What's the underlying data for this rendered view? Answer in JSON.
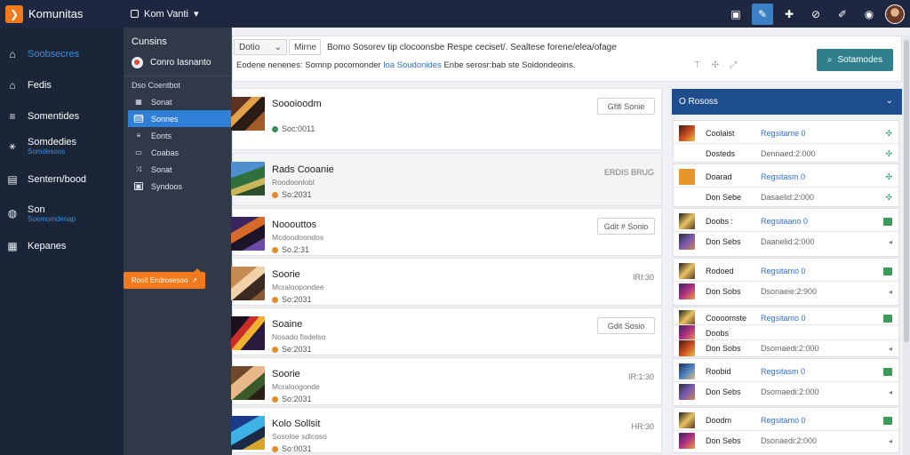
{
  "app": {
    "name": "Komunitas"
  },
  "workspace": {
    "label": "Kom Vanti"
  },
  "top_actions": [
    {
      "name": "calendar-icon",
      "glyph": "▣"
    },
    {
      "name": "edit-icon",
      "glyph": "✎"
    },
    {
      "name": "pin-icon",
      "glyph": "✚"
    },
    {
      "name": "attach-icon",
      "glyph": "⊘"
    },
    {
      "name": "wrench-icon",
      "glyph": "✐"
    },
    {
      "name": "notification-icon",
      "glyph": "◉"
    }
  ],
  "sidebar": {
    "items": [
      {
        "label": "Soobsecres",
        "icon": "home-icon",
        "glyph": "⌂",
        "blue": true
      },
      {
        "label": "Fedis",
        "icon": "house-icon",
        "glyph": "⌂"
      },
      {
        "label": "Somentides",
        "icon": "menu-icon",
        "glyph": "≡"
      },
      {
        "label": "Somdedies",
        "sub": "Somdesoos",
        "icon": "share-icon",
        "glyph": "⚹"
      },
      {
        "label": "Sentern/bood",
        "icon": "board-icon",
        "glyph": "▤"
      },
      {
        "label": "Son",
        "sub": "Soemomdenap",
        "icon": "globe-icon",
        "glyph": "◍"
      },
      {
        "label": "Kepanes",
        "icon": "chart-icon",
        "glyph": "▦"
      }
    ]
  },
  "dropdown": {
    "title": "Cunsins",
    "user": "Conro Iasnanto",
    "section": "Dso Coentbot",
    "items": [
      {
        "label": "Sonat",
        "icon": "grid-icon",
        "glyph": "▦"
      },
      {
        "label": "Sonnes",
        "icon": "chat-icon",
        "glyph": "⌨",
        "selected": true
      },
      {
        "label": "Eonts",
        "icon": "list-icon",
        "glyph": "≡"
      },
      {
        "label": "Coabas",
        "icon": "layout-icon",
        "glyph": "▭"
      },
      {
        "label": "Sonat",
        "icon": "shuffle-icon",
        "glyph": "⤨"
      },
      {
        "label": "Syndoos",
        "icon": "image-icon",
        "glyph": "▣"
      }
    ],
    "action": "Rooit Endrosesoo"
  },
  "composer": {
    "tab1": "Dotio",
    "tab2": "Mirne",
    "search": "Bomo Sosorev tip clocoonsbe Respe ceciset/. Sealtese forene/elea/ofage",
    "line_prefix": "Eodene nenenes: Somnp pocomonder",
    "line_link": "loa Soudonides",
    "line_suffix": "Enbe serosr:bab ste Soidondeoins.",
    "post_label": "Sotamodes"
  },
  "threads": [
    {
      "title": "Soooioodm",
      "sub": "",
      "meta": "Soc:0011",
      "dot": "green",
      "button": "Gfifi Sonie",
      "art": "g1",
      "grey": false
    },
    {
      "title": "Rads Cooanie",
      "sub": "Roodoonlobl",
      "meta": "So:2031",
      "dot": "orange",
      "right": "ERDIS BRUG",
      "art": "g2",
      "grey": true
    },
    {
      "title": "Nooouttos",
      "sub": "Mcdoodoondos",
      "meta": "So.2:31",
      "dot": "orange",
      "button": "Gdit # Sonio",
      "art": "g3",
      "grey": false
    },
    {
      "title": "Soorie",
      "sub": "Mcraloopondee",
      "meta": "So:2031",
      "dot": "orange",
      "right": "IRI:30",
      "art": "g4",
      "grey": false
    },
    {
      "title": "Soaine",
      "sub": "Nosado fisdelso",
      "meta": "Se:2031",
      "dot": "orange",
      "button": "Gdit Sosio",
      "art": "g5",
      "grey": false
    },
    {
      "title": "Soorie",
      "sub": "Mcraloogonde",
      "meta": "So:2031",
      "dot": "orange",
      "right": "IR:1:30",
      "art": "g6",
      "grey": false
    },
    {
      "title": "Kolo Sollsit",
      "sub": "Sosoloe sdlcoso",
      "meta": "So:0031",
      "dot": "orange",
      "right": "HR:30",
      "art": "g7",
      "grey": false
    }
  ],
  "right_panel": {
    "title": "O Rososs",
    "groups": [
      {
        "rows": [
          {
            "name": "Coolaist",
            "status": "Regsitame 0",
            "x": "✣",
            "art": "gi1"
          },
          {
            "name": "Dosteds",
            "date": "Dennaed:2:000",
            "x": "✣",
            "art": ""
          }
        ]
      },
      {
        "rows": [
          {
            "name": "Doarad",
            "status": "Regsitasm 0",
            "x": "✣",
            "art": "gi3"
          },
          {
            "name": "Don Sebe",
            "date": "Dasaelid:2:000",
            "x": "✣",
            "art": ""
          }
        ]
      },
      {
        "rows": [
          {
            "name": "Doobs :",
            "status": "Regsitaano 0",
            "xbox": true,
            "art": "gi4"
          },
          {
            "name": "Don Sebs",
            "date": "Daanelid:2:000",
            "x": "◂",
            "art": "gi2"
          }
        ]
      },
      {
        "rows": [
          {
            "name": "Rodoed",
            "status": "Regsitamo 0",
            "xbox": true,
            "art": "gi4"
          },
          {
            "name": "Don Sobs",
            "date": "Dsonaeie:2:900",
            "x": "◂",
            "art": "gi5"
          }
        ]
      },
      {
        "rows": [
          {
            "name": "Coooomste",
            "status": "Regsitamo 0",
            "xbox": true,
            "art": "gi4"
          },
          {
            "name": "Doobs",
            "date": "",
            "x": "",
            "art": "gi5"
          },
          {
            "name": "Don Sobs",
            "date": "Dsomaedi:2:000",
            "x": "◂",
            "art": "gi1"
          }
        ]
      },
      {
        "rows": [
          {
            "name": "Roobid",
            "status": "Regsitasm 0",
            "xbox": true,
            "art": "gi6"
          },
          {
            "name": "Don Sebs",
            "date": "Dsomaedi:2:000",
            "x": "◂",
            "art": "gi2"
          }
        ]
      },
      {
        "rows": [
          {
            "name": "Doodm",
            "status": "Regsitamo 0",
            "xbox": true,
            "art": "gi4"
          },
          {
            "name": "Don Sebs",
            "date": "Dsonaedi:2:000",
            "x": "◂",
            "art": "gi5"
          }
        ]
      }
    ]
  },
  "colors": {
    "topbar": "#1d2740",
    "sidebar": "#1b2538",
    "accent": "#2f7ed8",
    "orange": "#f07a1c",
    "teal": "#2f7f8c",
    "panel_head": "#1f4e8f"
  }
}
